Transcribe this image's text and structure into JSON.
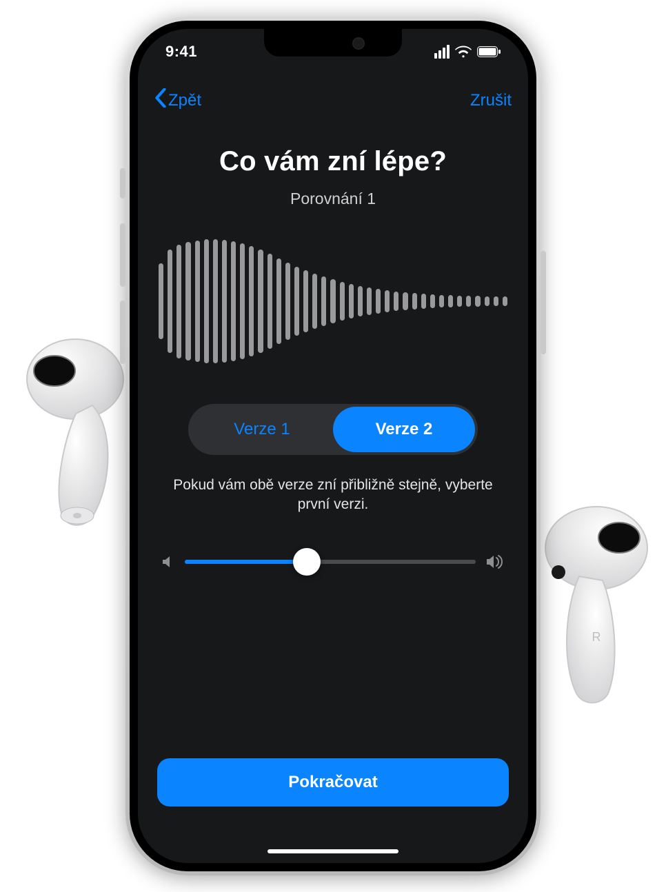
{
  "status": {
    "time": "9:41"
  },
  "nav": {
    "back_label": "Zpět",
    "cancel_label": "Zrušit"
  },
  "main": {
    "title": "Co vám zní lépe?",
    "subtitle": "Porovnání 1",
    "segments": {
      "v1": "Verze 1",
      "v2": "Verze 2",
      "selected": "v2"
    },
    "hint": "Pokud vám obě verze zní přibližně stejně, vyberte první verzi.",
    "volume_percent": 42,
    "continue_label": "Pokračovat"
  },
  "waveform_heights": [
    110,
    150,
    165,
    172,
    176,
    180,
    180,
    178,
    174,
    168,
    160,
    150,
    138,
    124,
    112,
    100,
    90,
    80,
    72,
    64,
    56,
    50,
    44,
    40,
    36,
    32,
    28,
    26,
    24,
    22,
    20,
    18,
    18,
    16,
    16,
    16,
    14,
    14,
    14
  ],
  "colors": {
    "accent": "#0a84ff"
  },
  "airpods": {
    "right_label": "R"
  }
}
